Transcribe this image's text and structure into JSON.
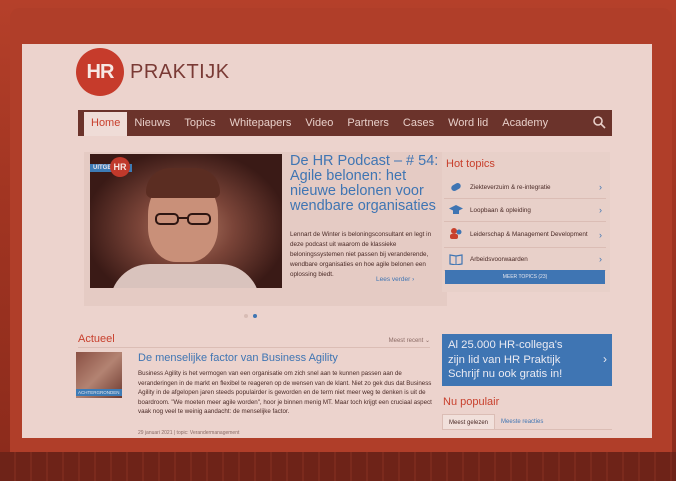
{
  "logo": {
    "mark": "HR",
    "text": "PRAKTIJK"
  },
  "nav": {
    "items": [
      "Home",
      "Nieuws",
      "Topics",
      "Whitepapers",
      "Video",
      "Partners",
      "Cases",
      "Word lid",
      "Academy"
    ],
    "active": "Home",
    "search_icon": "search-icon"
  },
  "slider": {
    "badge": "UITGELICHT",
    "badge_logo": "HR",
    "title": "De HR Podcast – # 54: Agile belonen: het nieuwe belonen voor wendbare organisaties",
    "description": "Lennart de Winter is beloningsconsultant en legt in deze podcast uit waarom de klassieke beloningssystemen niet passen bij veranderende, wendbare organisaties en hoe agile belonen een oplossing biedt.",
    "more": "Lees verder ›",
    "active_slide": 2,
    "slide_count": 2
  },
  "hot_topics": {
    "title": "Hot topics",
    "items": [
      {
        "label": "Ziekteverzuim & re-integratie",
        "icon": "bandage-icon"
      },
      {
        "label": "Loopbaan & opleiding",
        "icon": "graduation-cap-icon"
      },
      {
        "label": "Leiderschap & Management Development",
        "icon": "people-icon"
      },
      {
        "label": "Arbeidsvoorwaarden",
        "icon": "book-icon"
      }
    ],
    "button": "MEER TOPICS (23)"
  },
  "actueel": {
    "title": "Actueel",
    "sort": "Meest recent",
    "article": {
      "tag": "ACHTERGRONDEN",
      "title": "De menselijke factor van Business Agility",
      "body": "Business Agility is het vermogen van een organisatie om zich snel aan te kunnen passen aan de veranderingen in de markt en flexibel te reageren op de wensen van de klant. Niet zo gek dus dat Business Agility in de afgelopen jaren steeds populairder is geworden en de term niet meer weg te denken is uit de boardroom. \"We moeten meer agile worden\", hoor je binnen menig MT. Maar toch krijgt een cruciaal aspect vaak nog veel te weinig aandacht: de menselijke factor.",
      "meta": "29 januari 2021 | topic: Verandermanagement"
    }
  },
  "promo": {
    "line1": "Al 25.000 HR-collega's",
    "line2": "zijn lid van HR Praktijk",
    "line3": "Schrijf nu ook gratis in!"
  },
  "popular": {
    "title": "Nu populair",
    "tabs": [
      "Meest gelezen",
      "Meeste reacties"
    ],
    "active_tab": 0
  }
}
